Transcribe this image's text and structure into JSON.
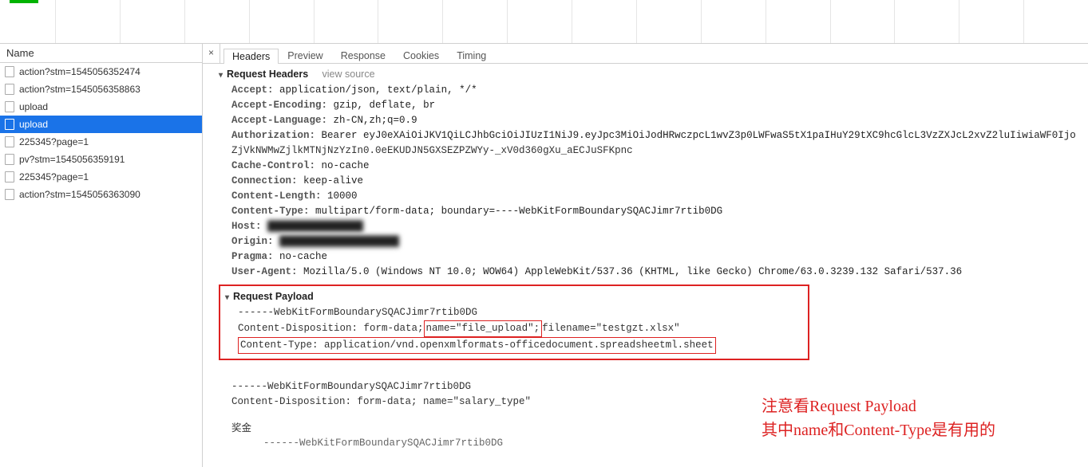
{
  "left": {
    "header": "Name",
    "items": [
      {
        "label": "action?stm=1545056352474"
      },
      {
        "label": "action?stm=1545056358863"
      },
      {
        "label": "upload"
      },
      {
        "label": "upload",
        "selected": true
      },
      {
        "label": "225345?page=1"
      },
      {
        "label": "pv?stm=1545056359191"
      },
      {
        "label": "225345?page=1"
      },
      {
        "label": "action?stm=1545056363090"
      }
    ]
  },
  "devtabs": {
    "close": "×",
    "items": [
      "Headers",
      "Preview",
      "Response",
      "Cookies",
      "Timing"
    ],
    "active": 0
  },
  "sections": {
    "requestHeaders": "Request Headers",
    "viewSource": "view source",
    "requestPayload": "Request Payload"
  },
  "headers": [
    {
      "k": "Accept:",
      "v": "application/json, text/plain, */*"
    },
    {
      "k": "Accept-Encoding:",
      "v": "gzip, deflate, br"
    },
    {
      "k": "Accept-Language:",
      "v": "zh-CN,zh;q=0.9"
    },
    {
      "k": "Authorization:",
      "v": "Bearer eyJ0eXAiOiJKV1QiLCJhbGciOiJIUzI1NiJ9.eyJpc3MiOiJodHRwczpcL1wvZ3p0LWFwaS5tX1paIHuY29tXC9hcGlcL3VzZXJcL2xvZ2luIiwiaWF0Ijo",
      "v2": "ZjVkNWMwZjlkMTNjNzYzIn0.0eEKUDJN5GXSEZPZWYy-_xV0d360gXu_aECJuSFKpnc"
    },
    {
      "k": "Cache-Control:",
      "v": "no-cache"
    },
    {
      "k": "Connection:",
      "v": "keep-alive"
    },
    {
      "k": "Content-Length:",
      "v": "10000"
    },
    {
      "k": "Content-Type:",
      "v": "multipart/form-data; boundary=----WebKitFormBoundarySQACJimr7rtib0DG"
    },
    {
      "k": "Host:",
      "v": "████████████████"
    },
    {
      "k": "Origin:",
      "v": "████████████████████"
    },
    {
      "k": "Pragma:",
      "v": "no-cache"
    },
    {
      "k": "User-Agent:",
      "v": "Mozilla/5.0 (Windows NT 10.0; WOW64) AppleWebKit/537.36 (KHTML, like Gecko) Chrome/63.0.3239.132 Safari/537.36"
    }
  ],
  "payload": {
    "boundary": "------WebKitFormBoundarySQACJimr7rtib0DG",
    "part1": {
      "dispPrefix": "Content-Disposition: form-data;",
      "nameSeg": " name=\"file_upload\"; ",
      "filenameSeg": "filename=\"testgzt.xlsx\"",
      "ctype": "Content-Type: application/vnd.openxmlformats-officedocument.spreadsheetml.sheet"
    },
    "part2": {
      "disp": "Content-Disposition: form-data; name=\"salary_type\"",
      "value": "奖金"
    },
    "trailingBoundary": "------WebKitFormBoundarySQACJimr7rtib0DG"
  },
  "annotation": {
    "line1": "注意看Request Payload",
    "line2": "其中name和Content-Type是有用的"
  }
}
